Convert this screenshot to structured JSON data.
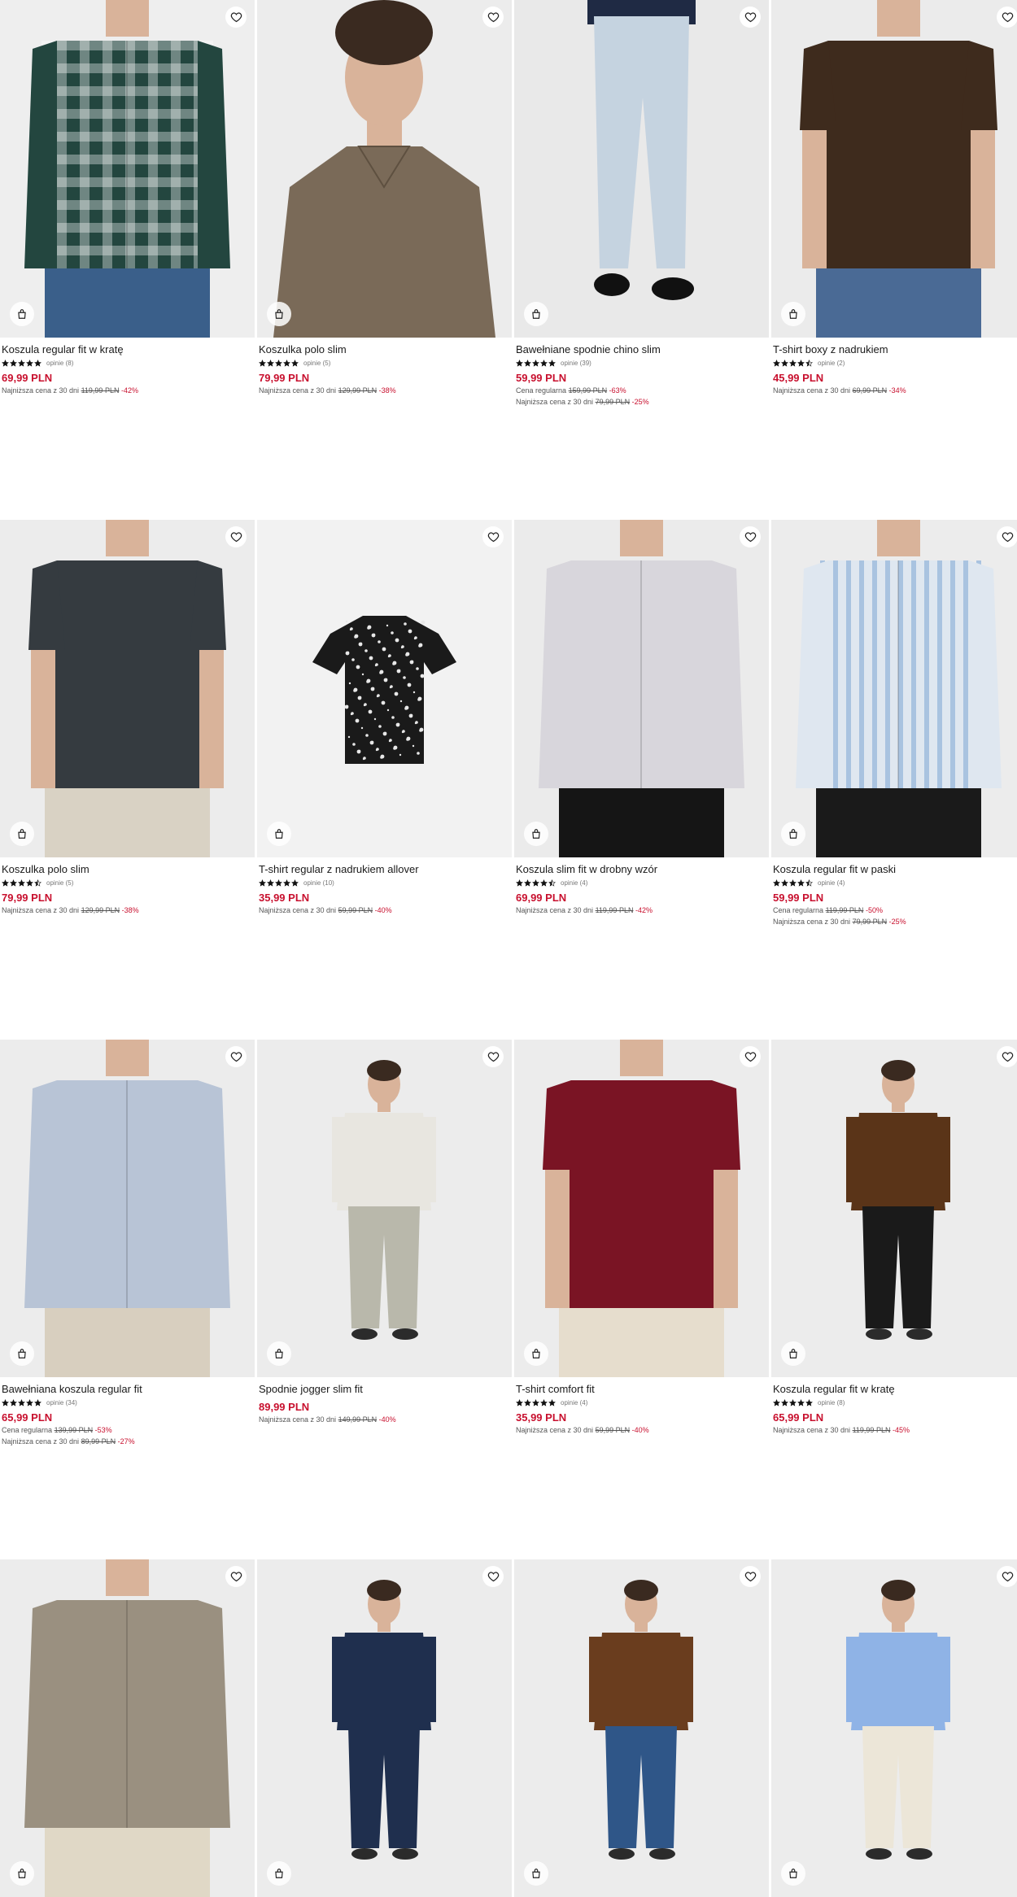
{
  "colors": {
    "price": "#c8102e",
    "discount": "#c8102e"
  },
  "products": [
    {
      "name": "Koszula regular fit w kratę",
      "stars": 5,
      "opinions": "opinie (8)",
      "price": "69,99 PLN",
      "notes": [
        {
          "label": "Najniższa cena z 30 dni",
          "old": "119,99 PLN",
          "disc": "-42%"
        }
      ],
      "look": {
        "bg": "#eeeeee",
        "top": "#23463f",
        "top2": "#ffffff",
        "bottom": "#3a5f8a",
        "kind": "shirt-check"
      }
    },
    {
      "name": "Koszulka polo slim",
      "stars": 5,
      "opinions": "opinie (5)",
      "price": "79,99 PLN",
      "notes": [
        {
          "label": "Najniższa cena z 30 dni",
          "old": "129,99 PLN",
          "disc": "-38%"
        }
      ],
      "look": {
        "bg": "#ececec",
        "top": "#7a6a58",
        "bottom": "#7a6a58",
        "kind": "portrait"
      }
    },
    {
      "name": "Bawełniane spodnie chino slim",
      "stars": 5,
      "opinions": "opinie (39)",
      "price": "59,99 PLN",
      "notes": [
        {
          "label": "Cena regularna",
          "old": "159,99 PLN",
          "disc": "-63%"
        },
        {
          "label": "Najniższa cena z 30 dni",
          "old": "79,99 PLN",
          "disc": "-25%"
        }
      ],
      "look": {
        "bg": "#e9e9e9",
        "top": "#1f2a44",
        "bottom": "#c5d3e0",
        "kind": "pants"
      }
    },
    {
      "name": "T-shirt boxy z nadrukiem",
      "stars": 4.5,
      "opinions": "opinie (2)",
      "price": "45,99 PLN",
      "notes": [
        {
          "label": "Najniższa cena z 30 dni",
          "old": "69,99 PLN",
          "disc": "-34%"
        }
      ],
      "look": {
        "bg": "#ebebeb",
        "top": "#3e2b1d",
        "bottom": "#4a6a95",
        "kind": "tee"
      }
    },
    {
      "name": "Koszulka polo slim",
      "stars": 4.5,
      "opinions": "opinie (5)",
      "price": "79,99 PLN",
      "notes": [
        {
          "label": "Najniższa cena z 30 dni",
          "old": "129,99 PLN",
          "disc": "-38%"
        }
      ],
      "look": {
        "bg": "#ececec",
        "top": "#353b40",
        "bottom": "#d9d2c4",
        "kind": "tee"
      }
    },
    {
      "name": "T-shirt regular z nadrukiem allover",
      "stars": 5,
      "opinions": "opinie (10)",
      "price": "35,99 PLN",
      "notes": [
        {
          "label": "Najniższa cena z 30 dni",
          "old": "59,99 PLN",
          "disc": "-40%"
        }
      ],
      "look": {
        "bg": "#f2f2f2",
        "top": "#1a1a1a",
        "bottom": "#1a1a1a",
        "kind": "flat-tee"
      }
    },
    {
      "name": "Koszula slim fit w drobny wzór",
      "stars": 4.5,
      "opinions": "opinie (4)",
      "price": "69,99 PLN",
      "notes": [
        {
          "label": "Najniższa cena z 30 dni",
          "old": "119,99 PLN",
          "disc": "-42%"
        }
      ],
      "look": {
        "bg": "#ebebeb",
        "top": "#d8d6dc",
        "bottom": "#151515",
        "kind": "shirt"
      }
    },
    {
      "name": "Koszula regular fit w paski",
      "stars": 4.5,
      "opinions": "opinie (4)",
      "price": "59,99 PLN",
      "notes": [
        {
          "label": "Cena regularna",
          "old": "119,99 PLN",
          "disc": "-50%"
        },
        {
          "label": "Najniższa cena z 30 dni",
          "old": "79,99 PLN",
          "disc": "-25%"
        }
      ],
      "look": {
        "bg": "#ececec",
        "top": "#dfe7f0",
        "bottom": "#1a1a1a",
        "kind": "shirt-stripe"
      }
    },
    {
      "name": "Bawełniana koszula regular fit",
      "stars": 5,
      "opinions": "opinie (34)",
      "price": "65,99 PLN",
      "notes": [
        {
          "label": "Cena regularna",
          "old": "139,99 PLN",
          "disc": "-53%"
        },
        {
          "label": "Najniższa cena z 30 dni",
          "old": "89,99 PLN",
          "disc": "-27%"
        }
      ],
      "look": {
        "bg": "#ececec",
        "top": "#b8c4d6",
        "bottom": "#d8cfbf",
        "kind": "shirt"
      }
    },
    {
      "name": "Spodnie jogger slim fit",
      "stars": 0,
      "opinions": "",
      "price": "89,99 PLN",
      "notes": [
        {
          "label": "Najniższa cena z 30 dni",
          "old": "149,99 PLN",
          "disc": "-40%"
        }
      ],
      "look": {
        "bg": "#ececec",
        "top": "#e8e6e0",
        "bottom": "#b9b8ab",
        "kind": "full"
      }
    },
    {
      "name": "T-shirt comfort fit",
      "stars": 5,
      "opinions": "opinie (4)",
      "price": "35,99 PLN",
      "notes": [
        {
          "label": "Najniższa cena z 30 dni",
          "old": "59,99 PLN",
          "disc": "-40%"
        }
      ],
      "look": {
        "bg": "#ececec",
        "top": "#7a1424",
        "bottom": "#e6ddcd",
        "kind": "tee"
      }
    },
    {
      "name": "Koszula regular fit w kratę",
      "stars": 5,
      "opinions": "opinie (8)",
      "price": "65,99 PLN",
      "notes": [
        {
          "label": "Najniższa cena z 30 dni",
          "old": "119,99 PLN",
          "disc": "-45%"
        }
      ],
      "look": {
        "bg": "#ececec",
        "top": "#5a3418",
        "bottom": "#1a1a1a",
        "kind": "full"
      }
    },
    {
      "name": "",
      "stars": 0,
      "opinions": "",
      "price": "",
      "notes": [],
      "look": {
        "bg": "#ececec",
        "top": "#9a9080",
        "bottom": "#e0d8c6",
        "kind": "shirt"
      }
    },
    {
      "name": "",
      "stars": 0,
      "opinions": "",
      "price": "",
      "notes": [],
      "look": {
        "bg": "#ececec",
        "top": "#1f2f4e",
        "bottom": "#1f2f4e",
        "kind": "full"
      }
    },
    {
      "name": "",
      "stars": 0,
      "opinions": "",
      "price": "",
      "notes": [],
      "look": {
        "bg": "#ececec",
        "top": "#6a3d1e",
        "bottom": "#2f5688",
        "kind": "full"
      }
    },
    {
      "name": "",
      "stars": 0,
      "opinions": "",
      "price": "",
      "notes": [],
      "look": {
        "bg": "#ececec",
        "top": "#8fb3e6",
        "bottom": "#ece6d8",
        "kind": "full"
      }
    }
  ]
}
